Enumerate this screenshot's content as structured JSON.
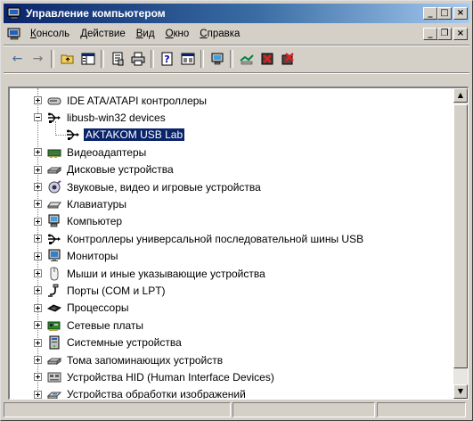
{
  "window": {
    "title": "Управление компьютером",
    "caption_buttons": {
      "minimize": "_",
      "maximize": "□",
      "close": "×"
    }
  },
  "menubar": {
    "items": [
      {
        "label": "Консоль",
        "accel": "К",
        "rest": "онсоль"
      },
      {
        "label": "Действие",
        "accel": "Д",
        "rest": "ействие"
      },
      {
        "label": "Вид",
        "accel": "В",
        "rest": "ид"
      },
      {
        "label": "Окно",
        "accel": "О",
        "rest": "кно"
      },
      {
        "label": "Справка",
        "accel": "С",
        "rest": "правка"
      }
    ],
    "mdi_buttons": {
      "minimize": "_",
      "restore": "❐",
      "close": "×"
    }
  },
  "toolbar": {
    "back_icon": "←",
    "forward_icon": "→",
    "buttons": [
      "back-arrow-icon",
      "forward-arrow-icon",
      "up-folder-icon",
      "show-hide-tree-icon",
      "properties-icon",
      "print-icon",
      "help-icon",
      "console-view-icon",
      "scan-hardware-icon",
      "update-driver-icon",
      "disable-device-icon",
      "uninstall-device-icon"
    ]
  },
  "tree": {
    "items": [
      {
        "label": "IDE ATA/ATAPI контроллеры",
        "icon": "ide-controller-icon",
        "expander": "plus",
        "level": 1
      },
      {
        "label": "libusb-win32 devices",
        "icon": "usb-icon",
        "expander": "minus",
        "level": 1
      },
      {
        "label": "AKTAKOM USB Lab",
        "icon": "usb-icon",
        "expander": "none",
        "level": 2,
        "selected": true
      },
      {
        "label": "Видеоадаптеры",
        "icon": "display-adapter-icon",
        "expander": "plus",
        "level": 1
      },
      {
        "label": "Дисковые устройства",
        "icon": "disk-drive-icon",
        "expander": "plus",
        "level": 1
      },
      {
        "label": "Звуковые, видео и игровые устройства",
        "icon": "sound-icon",
        "expander": "plus",
        "level": 1
      },
      {
        "label": "Клавиатуры",
        "icon": "keyboard-icon",
        "expander": "plus",
        "level": 1
      },
      {
        "label": "Компьютер",
        "icon": "computer-icon",
        "expander": "plus",
        "level": 1
      },
      {
        "label": "Контроллеры универсальной последовательной шины USB",
        "icon": "usb-icon",
        "expander": "plus",
        "level": 1
      },
      {
        "label": "Мониторы",
        "icon": "monitor-icon",
        "expander": "plus",
        "level": 1
      },
      {
        "label": "Мыши и иные указывающие устройства",
        "icon": "mouse-icon",
        "expander": "plus",
        "level": 1
      },
      {
        "label": "Порты (COM и LPT)",
        "icon": "port-icon",
        "expander": "plus",
        "level": 1
      },
      {
        "label": "Процессоры",
        "icon": "processor-icon",
        "expander": "plus",
        "level": 1
      },
      {
        "label": "Сетевые платы",
        "icon": "network-card-icon",
        "expander": "plus",
        "level": 1
      },
      {
        "label": "Системные устройства",
        "icon": "system-device-icon",
        "expander": "plus",
        "level": 1
      },
      {
        "label": "Тома запоминающих устройств",
        "icon": "storage-volume-icon",
        "expander": "plus",
        "level": 1
      },
      {
        "label": "Устройства HID (Human Interface Devices)",
        "icon": "hid-icon",
        "expander": "plus",
        "level": 1
      },
      {
        "label": "Устройства обработки изображений",
        "icon": "imaging-device-icon",
        "expander": "plus",
        "level": 1
      }
    ]
  },
  "scrollbar": {
    "up": "▲",
    "down": "▼"
  },
  "colors": {
    "titlebar_start": "#0a246a",
    "titlebar_end": "#a6caf0",
    "selection": "#0a246a",
    "face": "#d4d0c8"
  }
}
